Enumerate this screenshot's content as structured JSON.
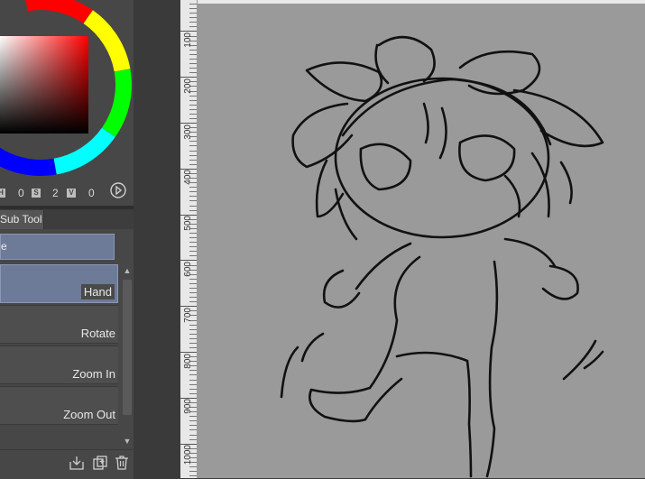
{
  "color_panel": {
    "hsv": [
      {
        "badge": "H",
        "value": "0"
      },
      {
        "badge": "S",
        "value": "2"
      },
      {
        "badge": "V",
        "value": "0"
      }
    ]
  },
  "subtool": {
    "tab_label": "Sub Tool",
    "group_label": "e",
    "items": [
      {
        "label": "Hand",
        "selected": true
      },
      {
        "label": "Rotate",
        "selected": false
      },
      {
        "label": "Zoom In",
        "selected": false
      },
      {
        "label": "Zoom Out",
        "selected": false
      }
    ]
  },
  "ruler": {
    "labels": [
      "100",
      "200",
      "300",
      "400",
      "500",
      "600",
      "700",
      "800",
      "900",
      "1000"
    ]
  }
}
